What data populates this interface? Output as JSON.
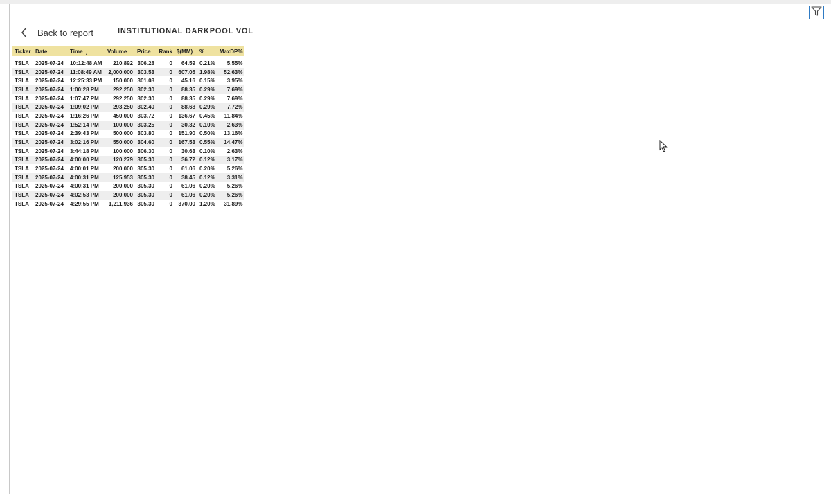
{
  "header": {
    "back_label": "Back to report",
    "title": "INSTITUTIONAL DARKPOOL VOL"
  },
  "toolbar": {
    "filter_icon": "filter-icon"
  },
  "table": {
    "columns": [
      "Ticker",
      "Date",
      "Time",
      "Volume",
      "Price",
      "Rank",
      "$(MM)",
      "%",
      "MaxDP%"
    ],
    "sorted_column": "Time",
    "rows": [
      [
        "TSLA",
        "2025-07-24",
        "10:12:48 AM",
        "210,892",
        "306.28",
        "0",
        "64.59",
        "0.21%",
        "5.55%"
      ],
      [
        "TSLA",
        "2025-07-24",
        "11:08:49 AM",
        "2,000,000",
        "303.53",
        "0",
        "607.05",
        "1.98%",
        "52.63%"
      ],
      [
        "TSLA",
        "2025-07-24",
        "12:25:33 PM",
        "150,000",
        "301.08",
        "0",
        "45.16",
        "0.15%",
        "3.95%"
      ],
      [
        "TSLA",
        "2025-07-24",
        "1:00:28 PM",
        "292,250",
        "302.30",
        "0",
        "88.35",
        "0.29%",
        "7.69%"
      ],
      [
        "TSLA",
        "2025-07-24",
        "1:07:47 PM",
        "292,250",
        "302.30",
        "0",
        "88.35",
        "0.29%",
        "7.69%"
      ],
      [
        "TSLA",
        "2025-07-24",
        "1:09:02 PM",
        "293,250",
        "302.40",
        "0",
        "88.68",
        "0.29%",
        "7.72%"
      ],
      [
        "TSLA",
        "2025-07-24",
        "1:16:26 PM",
        "450,000",
        "303.72",
        "0",
        "136.67",
        "0.45%",
        "11.84%"
      ],
      [
        "TSLA",
        "2025-07-24",
        "1:52:14 PM",
        "100,000",
        "303.25",
        "0",
        "30.32",
        "0.10%",
        "2.63%"
      ],
      [
        "TSLA",
        "2025-07-24",
        "2:39:43 PM",
        "500,000",
        "303.80",
        "0",
        "151.90",
        "0.50%",
        "13.16%"
      ],
      [
        "TSLA",
        "2025-07-24",
        "3:02:16 PM",
        "550,000",
        "304.60",
        "0",
        "167.53",
        "0.55%",
        "14.47%"
      ],
      [
        "TSLA",
        "2025-07-24",
        "3:44:18 PM",
        "100,000",
        "306.30",
        "0",
        "30.63",
        "0.10%",
        "2.63%"
      ],
      [
        "TSLA",
        "2025-07-24",
        "4:00:00 PM",
        "120,279",
        "305.30",
        "0",
        "36.72",
        "0.12%",
        "3.17%"
      ],
      [
        "TSLA",
        "2025-07-24",
        "4:00:01 PM",
        "200,000",
        "305.30",
        "0",
        "61.06",
        "0.20%",
        "5.26%"
      ],
      [
        "TSLA",
        "2025-07-24",
        "4:00:31 PM",
        "125,953",
        "305.30",
        "0",
        "38.45",
        "0.12%",
        "3.31%"
      ],
      [
        "TSLA",
        "2025-07-24",
        "4:00:31 PM",
        "200,000",
        "305.30",
        "0",
        "61.06",
        "0.20%",
        "5.26%"
      ],
      [
        "TSLA",
        "2025-07-24",
        "4:02:53 PM",
        "200,000",
        "305.30",
        "0",
        "61.06",
        "0.20%",
        "5.26%"
      ],
      [
        "TSLA",
        "2025-07-24",
        "4:29:55 PM",
        "1,211,936",
        "305.30",
        "0",
        "370.00",
        "1.20%",
        "31.89%"
      ]
    ]
  }
}
